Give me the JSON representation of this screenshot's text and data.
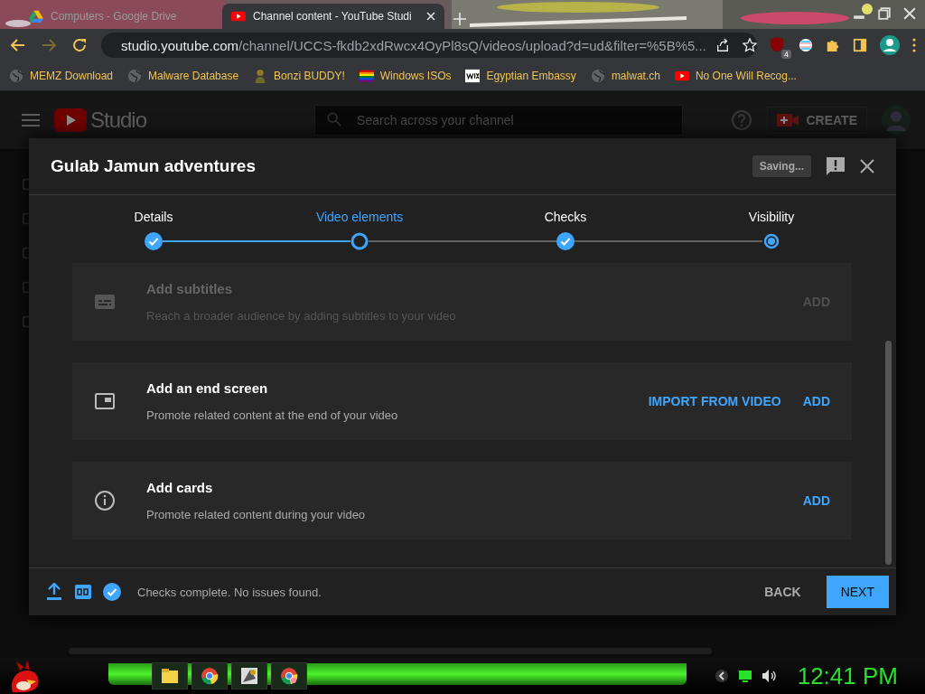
{
  "browser": {
    "tabs": [
      {
        "title": "Computers - Google Drive",
        "kind": "drive",
        "selected": false
      },
      {
        "title": "Channel content - YouTube Studi",
        "kind": "youtube",
        "selected": true
      }
    ],
    "url_host": "studio.youtube.com",
    "url_path": "/channel/UCCS-fkdb2xdRwcx4OyPl8sQ/videos/upload?d=ud&filter=%5B%5...",
    "extension_badge": "4",
    "bookmarks": [
      {
        "label": "MEMZ Download",
        "kind": "globe"
      },
      {
        "label": "Malware Database",
        "kind": "globe"
      },
      {
        "label": "Bonzi BUDDY!",
        "kind": "figure"
      },
      {
        "label": "Windows ISOs",
        "kind": "rainbow"
      },
      {
        "label": "Egyptian Embassy",
        "kind": "wix"
      },
      {
        "label": "malwat.ch",
        "kind": "globe"
      },
      {
        "label": "No One Will Recog...",
        "kind": "youtube"
      }
    ]
  },
  "studio": {
    "logo": "Studio",
    "search_placeholder": "Search across your channel",
    "create": "CREATE"
  },
  "dialog": {
    "title": "Gulab Jamun adventures",
    "saving": "Saving...",
    "steps": [
      {
        "label": "Details",
        "completed": true,
        "selected": false
      },
      {
        "label": "Video elements",
        "completed": false,
        "selected": true
      },
      {
        "label": "Checks",
        "completed": true,
        "selected": false
      },
      {
        "label": "Visibility",
        "completed": false,
        "selected": false
      }
    ],
    "elements": [
      {
        "kind": "subtitles",
        "title": "Add subtitles",
        "description": "Reach a broader audience by adding subtitles to your video",
        "disabled": true,
        "actions": [
          "ADD"
        ]
      },
      {
        "kind": "endscreen",
        "title": "Add an end screen",
        "description": "Promote related content at the end of your video",
        "disabled": false,
        "actions": [
          "IMPORT FROM VIDEO",
          "ADD"
        ]
      },
      {
        "kind": "info",
        "title": "Add cards",
        "description": "Promote related content during your video",
        "disabled": false,
        "actions": [
          "ADD"
        ]
      }
    ],
    "status": "Checks complete. No issues found.",
    "back": "BACK",
    "next": "NEXT"
  },
  "taskbar": {
    "clock": "12:41 PM"
  }
}
